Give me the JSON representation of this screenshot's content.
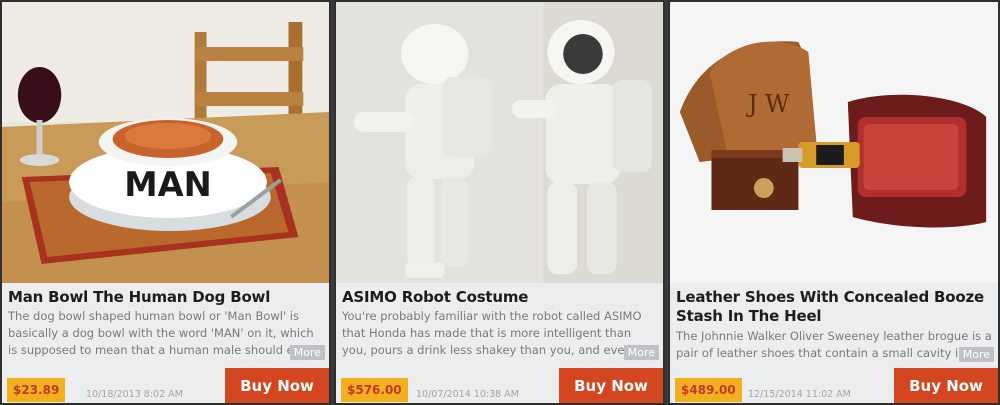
{
  "products": [
    {
      "title": "Man Bowl The Human Dog Bowl",
      "description": "The dog bowl shaped human bowl or 'Man Bowl' is basically a dog bowl with the word 'MAN' on it, which is supposed to mean that a human male should eat f ...",
      "more_label": "More",
      "price": "$23.89",
      "date": "10/18/2013 8:02 AM",
      "buy_label": "Buy Now",
      "image_text": "MAN"
    },
    {
      "title": "ASIMO Robot Costume",
      "description": "You're probably familiar with the robot called ASIMO that Honda has made that is more intelligent than you, pours a drink less shakey than you, and even has a ...",
      "more_label": "More",
      "price": "$576.00",
      "date": "10/07/2014 10:38 AM",
      "buy_label": "Buy Now"
    },
    {
      "title": "Leather Shoes With Concealed Booze Stash In The Heel",
      "description": "The Johnnie Walker Oliver Sweeney leather brogue is a pair of leather shoes that contain a small cavity in ...",
      "more_label": "More",
      "price": "$489.00",
      "date": "12/15/2014 11:02 AM",
      "buy_label": "Buy Now",
      "image_text": "J W"
    }
  ],
  "colors": {
    "buy_button": "#d3461f",
    "price_badge": "#f2b01e",
    "price_text": "#c0392b",
    "card_bg": "#ecedef"
  }
}
